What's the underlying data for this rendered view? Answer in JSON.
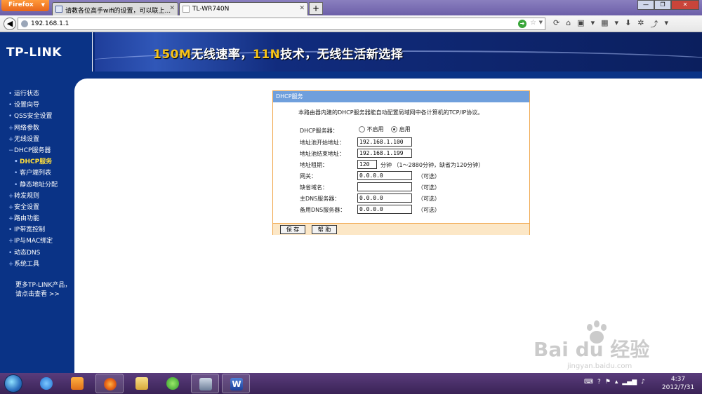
{
  "browser": {
    "menu_button": "Firefox",
    "tabs": [
      {
        "title": "请教各位高手wifi的设置，可以联上..."
      },
      {
        "title": "TL-WR740N"
      }
    ],
    "new_tab": "+",
    "url": "192.168.1.1"
  },
  "header": {
    "logo": "TP-LINK",
    "slogan_parts": [
      "150M",
      "无线速率，",
      "11N",
      "技术，无线生活新选择"
    ]
  },
  "sidebar": {
    "items": [
      {
        "label": "运行状态",
        "bullet": "•"
      },
      {
        "label": "设置向导",
        "bullet": "•"
      },
      {
        "label": "QSS安全设置",
        "bullet": "•"
      },
      {
        "label": "网络参数",
        "bullet": "+"
      },
      {
        "label": "无线设置",
        "bullet": "+"
      },
      {
        "label": "DHCP服务器",
        "bullet": "−"
      },
      {
        "label": "DHCP服务",
        "bullet": "•"
      },
      {
        "label": "客户端列表",
        "bullet": "•"
      },
      {
        "label": "静态地址分配",
        "bullet": "•"
      },
      {
        "label": "转发规则",
        "bullet": "+"
      },
      {
        "label": "安全设置",
        "bullet": "+"
      },
      {
        "label": "路由功能",
        "bullet": "+"
      },
      {
        "label": "IP带宽控制",
        "bullet": "•"
      },
      {
        "label": "IP与MAC绑定",
        "bullet": "+"
      },
      {
        "label": "动态DNS",
        "bullet": "•"
      },
      {
        "label": "系统工具",
        "bullet": "+"
      }
    ],
    "more_line1": "更多TP-LINK产品，",
    "more_line2": "请点击查看 >>"
  },
  "dhcp": {
    "title": "DHCP服务",
    "description": "本路由器内建的DHCP服务器能自动配置局域网中各计算机的TCP/IP协议。",
    "server_label": "DHCP服务器：",
    "disable_label": "不启用",
    "enable_label": "启用",
    "start_label": "地址池开始地址：",
    "start_value": "192.168.1.100",
    "end_label": "地址池结束地址：",
    "end_value": "192.168.1.199",
    "lease_label": "地址租期：",
    "lease_value": "120",
    "lease_unit": "分钟 （1～2880分钟，缺省为120分钟）",
    "gateway_label": "网关：",
    "gateway_value": "0.0.0.0",
    "domain_label": "缺省域名：",
    "domain_value": "",
    "dns1_label": "主DNS服务器：",
    "dns1_value": "0.0.0.0",
    "dns2_label": "备用DNS服务器：",
    "dns2_value": "0.0.0.0",
    "optional": "（可选）",
    "save_button": "保 存",
    "help_button": "帮 助"
  },
  "watermark": {
    "text": "Bai du 经验",
    "url": "jingyan.baidu.com"
  },
  "taskbar": {
    "time": "4:37",
    "date": "2012/7/31"
  },
  "colors": {
    "nav_blue": "#0a3386",
    "panel_border": "#f0a64a",
    "panel_title": "#6f9fdc",
    "active_menu": "#ffde3b"
  }
}
